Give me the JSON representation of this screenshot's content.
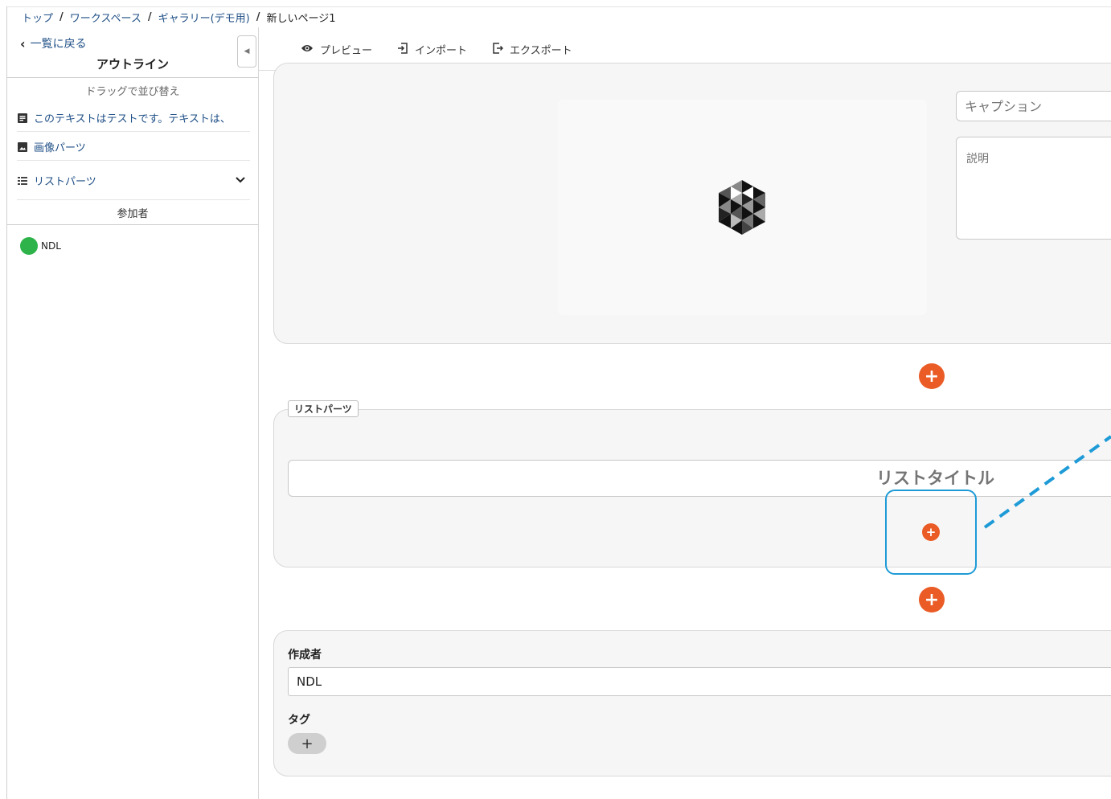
{
  "breadcrumb": {
    "items": [
      "トップ",
      "ワークスペース",
      "ギャラリー(デモ用)"
    ],
    "current": "新しいページ1",
    "separator": "/"
  },
  "sidebar": {
    "back_label": "一覧に戻る",
    "outline_title": "アウトライン",
    "drag_hint": "ドラッグで並び替え",
    "items": [
      {
        "label": "このテキストはテストです。テキストは、",
        "icon": "text-icon"
      },
      {
        "label": "画像パーツ",
        "icon": "image-icon"
      },
      {
        "label": "リストパーツ",
        "icon": "list-icon"
      }
    ],
    "participants_title": "参加者",
    "participants": [
      {
        "name": "NDL",
        "color": "#2db34a"
      }
    ]
  },
  "toolbar": {
    "preview_label": "プレビュー",
    "import_label": "インポート",
    "export_label": "エクスポート"
  },
  "image_part": {
    "caption_placeholder": "キャプション",
    "description_placeholder": "説明"
  },
  "list_part": {
    "legend": "リストパーツ",
    "title_placeholder": "リストタイトル"
  },
  "meta": {
    "author_label": "作成者",
    "author_value": "NDL",
    "tag_label": "タグ",
    "tag_add": "+"
  },
  "colors": {
    "accent": "#ea5b25",
    "link": "#1f4f86",
    "highlight": "#1e9bd7",
    "participant": "#2db34a"
  }
}
